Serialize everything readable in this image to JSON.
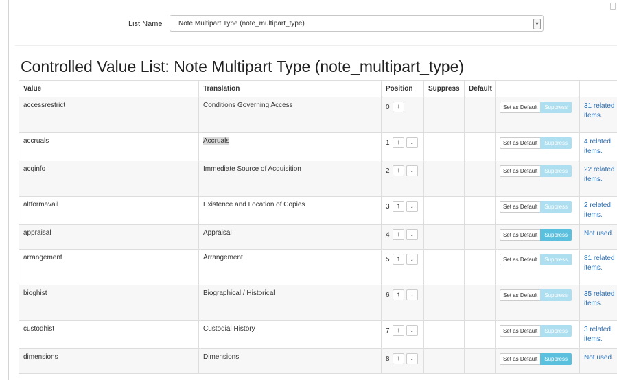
{
  "header": {
    "list_label": "List Name",
    "list_select_value": "Note Multipart Type (note_multipart_type)"
  },
  "title": "Controlled Value List: Note Multipart Type (note_multipart_type)",
  "table": {
    "columns": [
      "Value",
      "Translation",
      "Position",
      "Suppress",
      "Default",
      "",
      ""
    ],
    "set_default_label": "Set as Default",
    "suppress_label": "Suppress",
    "rows": [
      {
        "value": "accessrestrict",
        "translation": "Conditions Governing Access",
        "position": "0",
        "up": false,
        "related": "31 related items.",
        "suppress_active": false
      },
      {
        "value": "accruals",
        "translation": "Accruals",
        "position": "1",
        "up": true,
        "related": "4 related items.",
        "suppress_active": false
      },
      {
        "value": "acqinfo",
        "translation": "Immediate Source of Acquisition",
        "position": "2",
        "up": true,
        "related": "22 related items.",
        "suppress_active": false
      },
      {
        "value": "altformavail",
        "translation": "Existence and Location of Copies",
        "position": "3",
        "up": true,
        "related": "2 related items.",
        "suppress_active": false
      },
      {
        "value": "appraisal",
        "translation": "Appraisal",
        "position": "4",
        "up": true,
        "related": "Not used.",
        "suppress_active": true
      },
      {
        "value": "arrangement",
        "translation": "Arrangement",
        "position": "5",
        "up": true,
        "related": "81 related items.",
        "suppress_active": false
      },
      {
        "value": "bioghist",
        "translation": "Biographical / Historical",
        "position": "6",
        "up": true,
        "related": "35 related items.",
        "suppress_active": false
      },
      {
        "value": "custodhist",
        "translation": "Custodial History",
        "position": "7",
        "up": true,
        "related": "3 related items.",
        "suppress_active": false
      },
      {
        "value": "dimensions",
        "translation": "Dimensions",
        "position": "8",
        "up": true,
        "related": "Not used.",
        "suppress_active": true
      }
    ]
  },
  "icons": {
    "up_arrow": "arrow-up-icon",
    "down_arrow": "arrow-down-icon",
    "dropdown": "chevron-updown-icon"
  },
  "colors": {
    "link": "#2a6fb5",
    "suppress": "#5bc0de",
    "suppress_faded": "#aedff0"
  }
}
